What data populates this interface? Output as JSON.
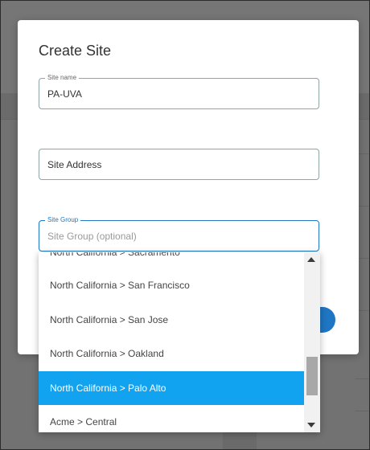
{
  "modal": {
    "title": "Create Site",
    "fields": {
      "site_name": {
        "label": "Site name",
        "value": "PA-UVA"
      },
      "site_address": {
        "placeholder": "Site Address"
      },
      "site_group": {
        "label": "Site Group",
        "placeholder": "Site Group (optional)"
      }
    }
  },
  "dropdown": {
    "items": [
      "North California > Sacramento",
      "North California > San Francisco",
      "North California > San Jose",
      "North California > Oakland",
      "North California > Palo Alto",
      "Acme > Central"
    ],
    "selected_index": 4
  },
  "colors": {
    "accent": "#1f76c2",
    "selected_item": "#12a3f0",
    "overlay": "#727272"
  }
}
